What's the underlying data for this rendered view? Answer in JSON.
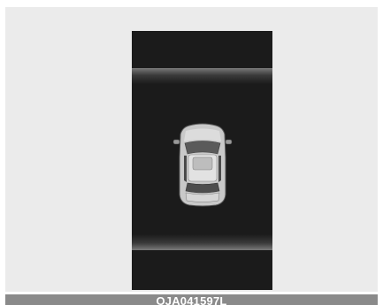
{
  "display": {
    "vehicle_icon": "car-top-view-icon"
  },
  "footer": {
    "image_code": "OJA041597L"
  },
  "colors": {
    "screen_background": "#1b1b1b",
    "panel_background": "#ebebeb",
    "footer_bar": "#8a8a8a"
  }
}
